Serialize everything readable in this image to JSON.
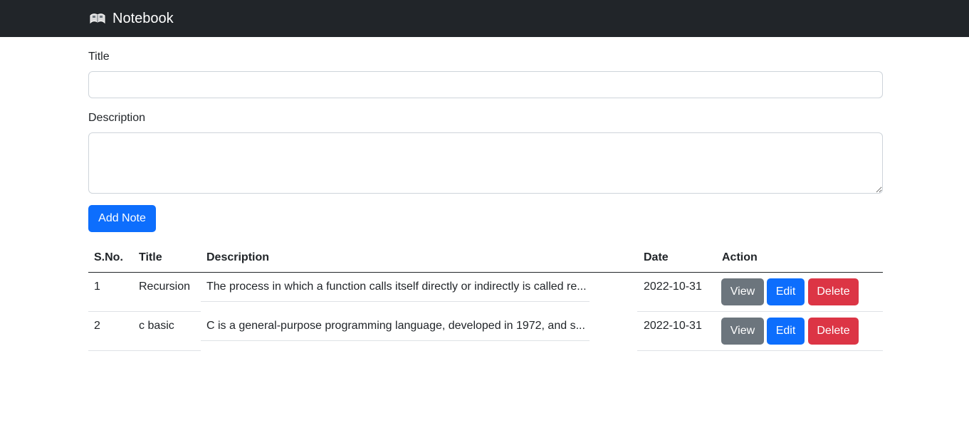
{
  "navbar": {
    "brand_icon": "notebook-icon",
    "brand_label": "Notebook"
  },
  "form": {
    "title_label": "Title",
    "title_value": "",
    "description_label": "Description",
    "description_value": "",
    "add_button_label": "Add Note"
  },
  "table": {
    "headers": [
      "S.No.",
      "Title",
      "Description",
      "Date",
      "Action"
    ],
    "rows": [
      {
        "sno": "1",
        "title": "Recursion",
        "description": "The process in which a function calls itself directly or indirectly is called re...",
        "date": "2022-10-31",
        "view_label": "View",
        "edit_label": "Edit",
        "delete_label": "Delete"
      },
      {
        "sno": "2",
        "title": "c basic",
        "description": "C is a general-purpose programming language, developed in 1972, and s...",
        "date": "2022-10-31",
        "view_label": "View",
        "edit_label": "Edit",
        "delete_label": "Delete"
      }
    ]
  },
  "colors": {
    "navbar_bg": "#212529",
    "primary": "#0d6efd",
    "secondary": "#6c757d",
    "danger": "#dc3545"
  }
}
